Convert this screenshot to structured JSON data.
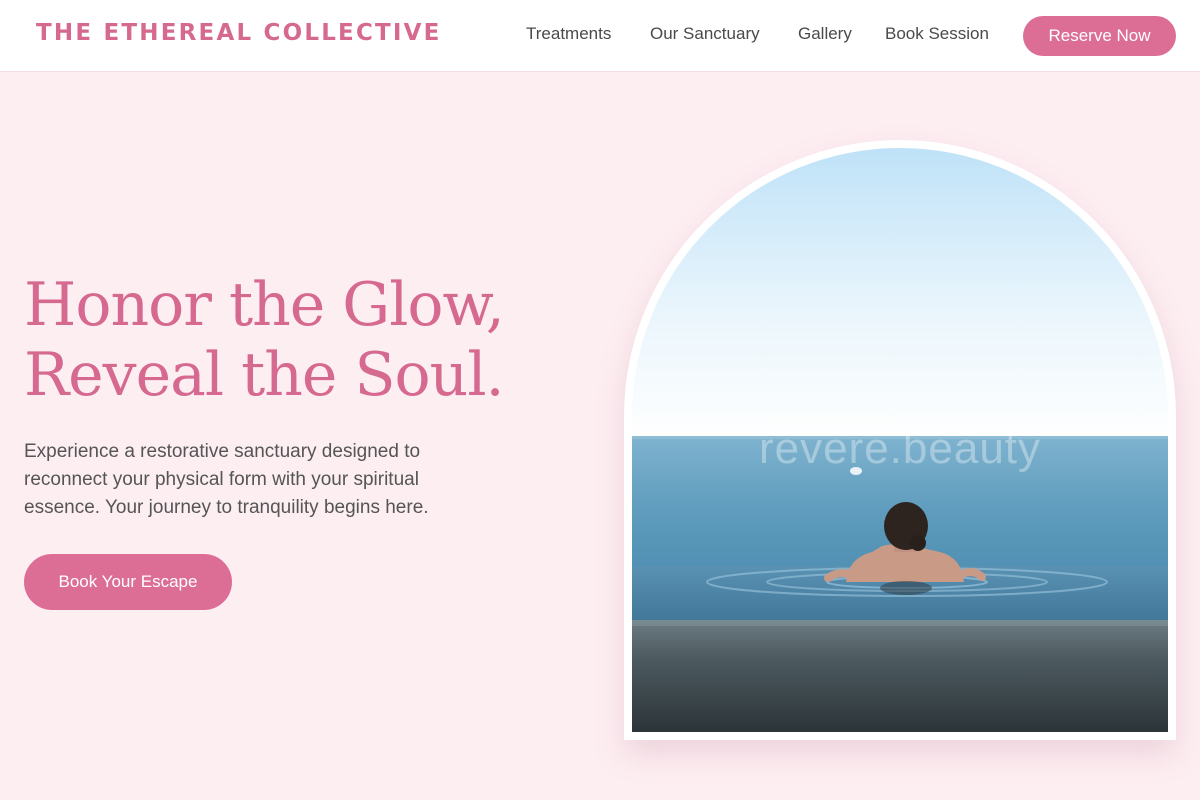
{
  "brand": {
    "name": "THE ETHEREAL COLLECTIVE"
  },
  "nav": {
    "items": [
      {
        "label": "Treatments"
      },
      {
        "label": "Our Sanctuary"
      },
      {
        "label": "Gallery"
      },
      {
        "label": "Book Session"
      }
    ],
    "reserve_label": "Reserve Now"
  },
  "hero": {
    "title_line1": "Honor the Glow,",
    "title_line2": "Reveal the Soul.",
    "description": "Experience a restorative sanctuary designed to reconnect your physical form with your spiritual essence. Your journey to tranquility begins here.",
    "cta_label": "Book Your Escape"
  },
  "image": {
    "watermark": "revere.beauty",
    "subject": "woman-in-infinity-pool-facing-sea"
  },
  "colors": {
    "accent": "#dc6e95",
    "brand_text": "#d6698f",
    "background": "#fdeef2",
    "body_text": "#555555"
  }
}
